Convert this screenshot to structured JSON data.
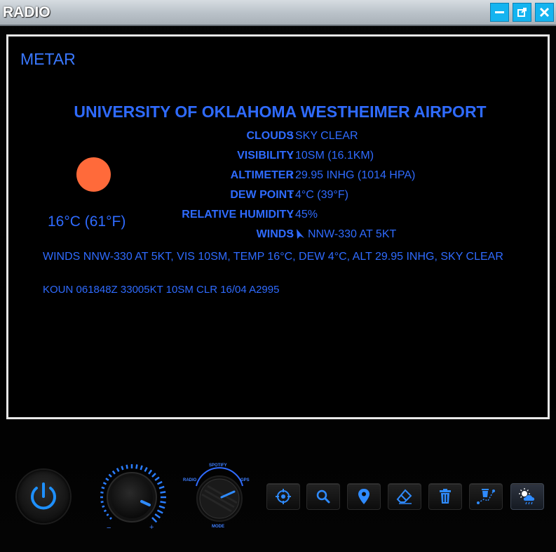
{
  "window": {
    "title": "RADIO",
    "minimize_icon": "minimize-icon",
    "popout_icon": "popout-icon",
    "close_icon": "close-icon"
  },
  "screen": {
    "label": "METAR",
    "airport_name": "UNIVERSITY OF OKLAHOMA WESTHEIMER AIRPORT",
    "rows": [
      {
        "key": "CLOUDS",
        "value": "SKY CLEAR"
      },
      {
        "key": "VISIBILITY",
        "value": "10SM (16.1KM)"
      },
      {
        "key": "ALTIMETER",
        "value": "29.95 INHG (1014 HPA)"
      },
      {
        "key": "DEW POINT",
        "value": "4°C (39°F)"
      },
      {
        "key": "RELATIVE HUMIDITY",
        "value": "45%"
      },
      {
        "key": "WINDS",
        "value": "NNW-330 AT 5KT"
      }
    ],
    "weather_icon": "sun-icon",
    "temperature": "16°C (61°F)",
    "summary": "WINDS NNW-330 AT 5KT, VIS 10SM, TEMP 16°C, DEW 4°C, ALT 29.95 INHG, SKY CLEAR",
    "raw_metar": "KOUN 061848Z 33005KT 10SM CLR 16/04 A2995"
  },
  "controls": {
    "volume_minus": "−",
    "volume_plus": "+",
    "mode_labels": {
      "top": "SPOTIFY",
      "left": "RADIO",
      "right": "GPS",
      "bottom": "MODE"
    },
    "tools": [
      {
        "name": "crosshair",
        "icon": "crosshair-icon"
      },
      {
        "name": "search",
        "icon": "search-icon"
      },
      {
        "name": "location",
        "icon": "map-pin-icon"
      },
      {
        "name": "eraser",
        "icon": "eraser-icon"
      },
      {
        "name": "delete",
        "icon": "trash-icon"
      },
      {
        "name": "delete-route",
        "icon": "trash-route-icon"
      },
      {
        "name": "weather",
        "icon": "weather-icon",
        "active": true
      }
    ]
  },
  "colors": {
    "accent": "#2f6bff",
    "window_button": "#14b4f0",
    "sun": "#ff6a3a"
  }
}
